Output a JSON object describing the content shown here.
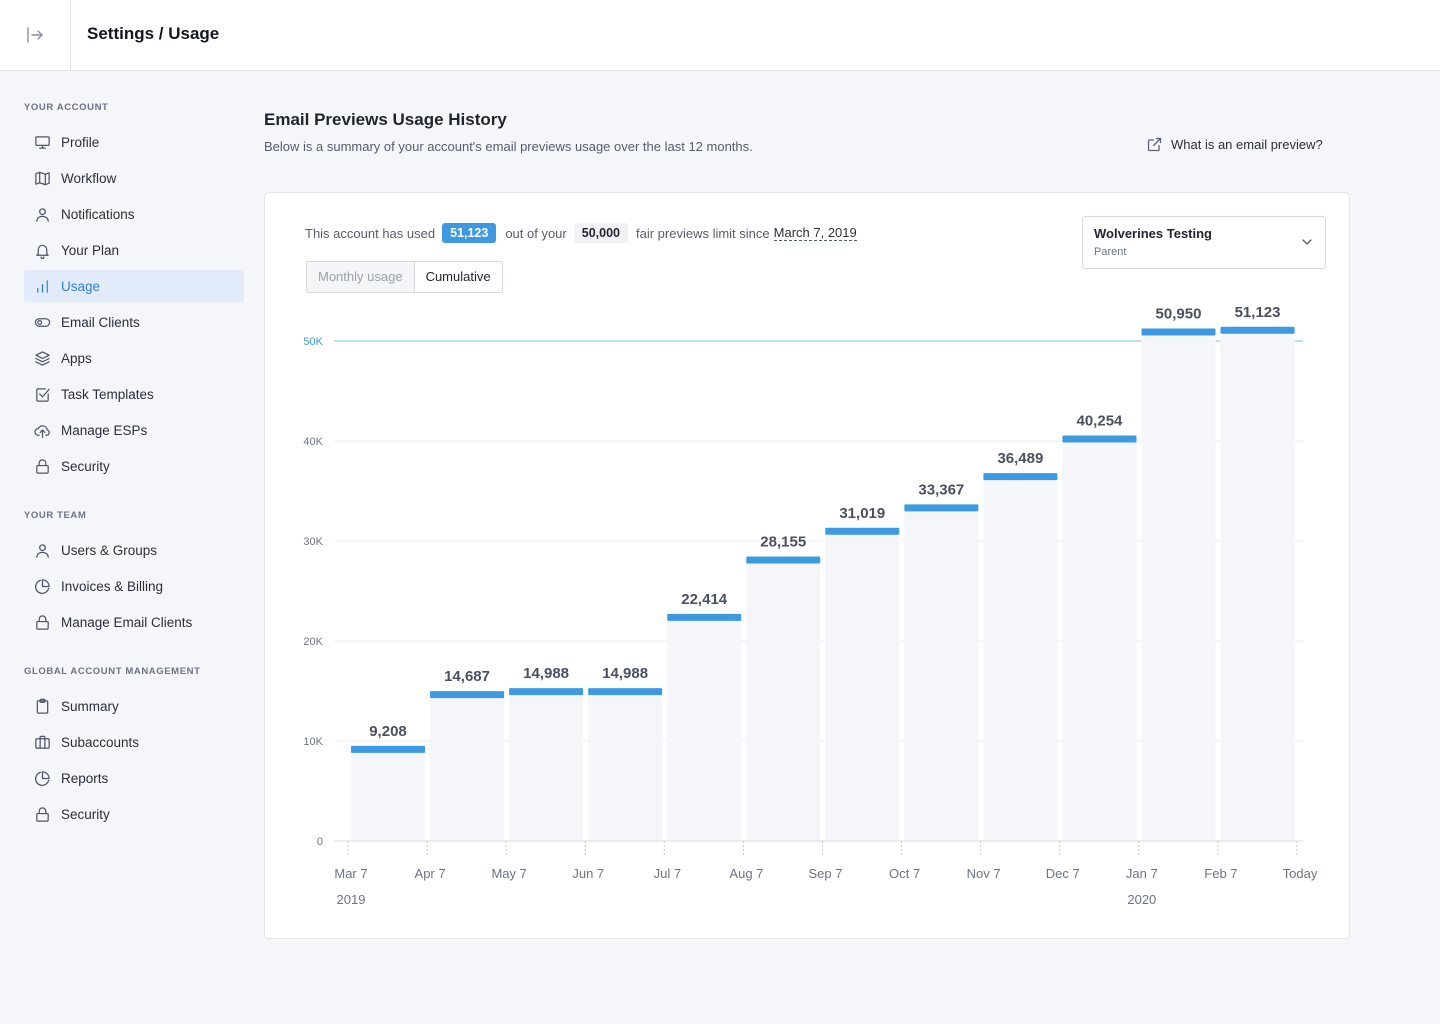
{
  "header": {
    "breadcrumb": "Settings / Usage"
  },
  "sidebar": {
    "sections": [
      {
        "title": "YOUR ACCOUNT",
        "items": [
          {
            "label": "Profile",
            "icon": "monitor-icon",
            "active": false
          },
          {
            "label": "Workflow",
            "icon": "map-icon",
            "active": false
          },
          {
            "label": "Notifications",
            "icon": "user-icon",
            "active": false
          },
          {
            "label": "Your Plan",
            "icon": "bell-icon",
            "active": false
          },
          {
            "label": "Usage",
            "icon": "bar-chart-icon",
            "active": true
          },
          {
            "label": "Email Clients",
            "icon": "toggle-icon",
            "active": false
          },
          {
            "label": "Apps",
            "icon": "layers-icon",
            "active": false
          },
          {
            "label": "Task Templates",
            "icon": "check-square-icon",
            "active": false
          },
          {
            "label": "Manage ESPs",
            "icon": "upload-cloud-icon",
            "active": false
          },
          {
            "label": "Security",
            "icon": "lock-icon",
            "active": false
          }
        ]
      },
      {
        "title": "YOUR TEAM",
        "items": [
          {
            "label": "Users & Groups",
            "icon": "user-icon",
            "active": false
          },
          {
            "label": "Invoices & Billing",
            "icon": "pie-chart-icon",
            "active": false
          },
          {
            "label": "Manage Email Clients",
            "icon": "lock-icon",
            "active": false
          }
        ]
      },
      {
        "title": "GLOBAL ACCOUNT MANAGEMENT",
        "items": [
          {
            "label": "Summary",
            "icon": "clipboard-icon",
            "active": false
          },
          {
            "label": "Subaccounts",
            "icon": "briefcase-icon",
            "active": false
          },
          {
            "label": "Reports",
            "icon": "pie-chart-icon",
            "active": false
          },
          {
            "label": "Security",
            "icon": "lock-icon",
            "active": false
          }
        ]
      }
    ]
  },
  "main": {
    "title": "Email Previews Usage History",
    "subtitle": "Below is a summary of your account's email previews usage over the last 12 months.",
    "help_link": "What is an email preview?",
    "usage": {
      "prefix": "This account has used",
      "used": "51,123",
      "middle": "out of your",
      "limit": "50,000",
      "suffix": "fair previews limit since",
      "since": "March 7, 2019"
    },
    "toggle": {
      "monthly": "Monthly usage",
      "cumulative": "Cumulative",
      "selected": "Cumulative"
    },
    "account_select": {
      "name": "Wolverines Testing",
      "role": "Parent"
    }
  },
  "colors": {
    "accent": "#3d9ae0",
    "active_bg": "#e1ebfa",
    "limit_line": "#7fc3de",
    "bar_fill": "#f5f6f9"
  },
  "chart_data": {
    "type": "bar",
    "categories": [
      "Mar 7",
      "Apr 7",
      "May 7",
      "Jun 7",
      "Jul 7",
      "Aug 7",
      "Sep 7",
      "Oct 7",
      "Nov 7",
      "Dec 7",
      "Jan 7",
      "Feb 7"
    ],
    "x_tick_labels": [
      "Mar 7",
      "Apr 7",
      "May 7",
      "Jun 7",
      "Jul 7",
      "Aug 7",
      "Sep 7",
      "Oct 7",
      "Nov 7",
      "Dec 7",
      "Jan 7",
      "Feb 7",
      "Today"
    ],
    "year_labels": [
      {
        "at": "Mar 7",
        "text": "2019"
      },
      {
        "at": "Jan 7",
        "text": "2020"
      }
    ],
    "values": [
      9208,
      14687,
      14988,
      14988,
      22414,
      28155,
      31019,
      33367,
      36489,
      40254,
      50950,
      51123
    ],
    "value_labels": [
      "9,208",
      "14,687",
      "14,988",
      "14,988",
      "22,414",
      "28,155",
      "31,019",
      "33,367",
      "36,489",
      "40,254",
      "50,950",
      "51,123"
    ],
    "y_ticks": [
      0,
      10000,
      20000,
      30000,
      40000,
      50000
    ],
    "y_tick_labels": [
      "0",
      "10K",
      "20K",
      "30K",
      "40K",
      "50K"
    ],
    "limit": 50000,
    "ylim": [
      0,
      50000
    ],
    "grid": true
  }
}
